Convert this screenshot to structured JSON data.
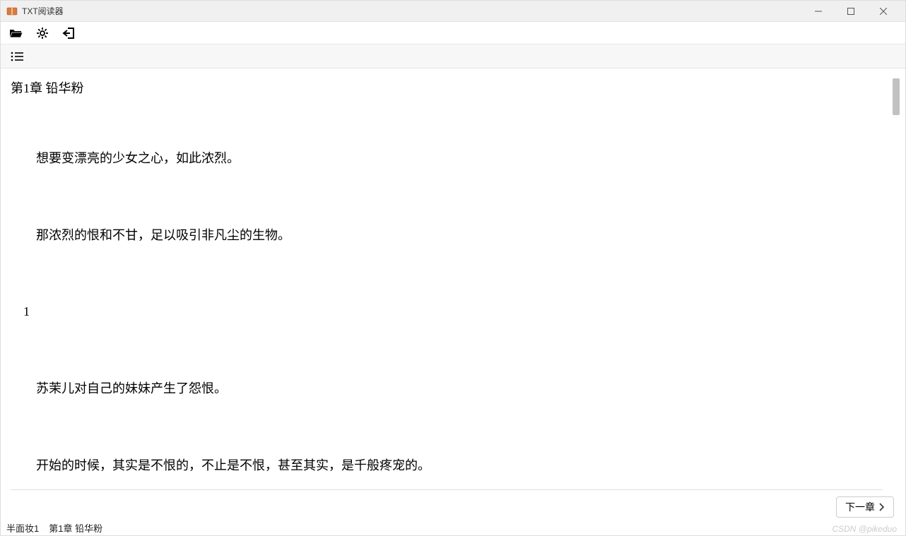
{
  "window": {
    "title": "TXT阅读器"
  },
  "toolbar": {
    "open_icon": "folder-open-icon",
    "settings_icon": "gear-icon",
    "exit_icon": "exit-icon"
  },
  "subbar": {
    "list_icon": "list-icon"
  },
  "reader": {
    "chapter_title": "第1章 铅华粉",
    "paragraphs": [
      "想要变漂亮的少女之心，如此浓烈。",
      "那浓烈的恨和不甘，足以吸引非凡尘的生物。",
      "1",
      "苏茉儿对自己的妹妹产生了怨恨。",
      "开始的时候，其实是不恨的，不止是不恨，甚至其实，是千般疼宠的。"
    ]
  },
  "footer": {
    "next_label": "下一章"
  },
  "status": {
    "book": "半面妆1",
    "chapter": "第1章 铅华粉"
  },
  "watermark": "CSDN @pikeduo"
}
